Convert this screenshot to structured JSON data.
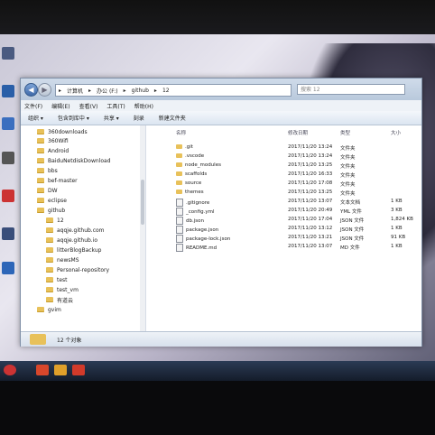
{
  "window": {
    "address_path": [
      "计算机",
      "办公 (F:)",
      "github",
      "12"
    ],
    "search_placeholder": "搜索 12",
    "menu": [
      "文件(F)",
      "编辑(E)",
      "查看(V)",
      "工具(T)",
      "帮助(H)"
    ],
    "toolbar": [
      "组织 ▾",
      "包含到库中 ▾",
      "共享 ▾",
      "刻录",
      "新建文件夹"
    ]
  },
  "nav": {
    "items": [
      {
        "label": "360downloads",
        "indent": 0
      },
      {
        "label": "360Wifi",
        "indent": 0
      },
      {
        "label": "Android",
        "indent": 0
      },
      {
        "label": "BaiduNetdiskDownload",
        "indent": 0
      },
      {
        "label": "bbs",
        "indent": 0
      },
      {
        "label": "bef-master",
        "indent": 0
      },
      {
        "label": "DW",
        "indent": 0
      },
      {
        "label": "eclipse",
        "indent": 0
      },
      {
        "label": "github",
        "indent": 0
      },
      {
        "label": "12",
        "indent": 1
      },
      {
        "label": "aqqje.github.com",
        "indent": 1
      },
      {
        "label": "aqqje.github.io",
        "indent": 1
      },
      {
        "label": "litterBlogBackup",
        "indent": 1
      },
      {
        "label": "newsMS",
        "indent": 1
      },
      {
        "label": "Personal-repository",
        "indent": 1
      },
      {
        "label": "test",
        "indent": 1
      },
      {
        "label": "test_vm",
        "indent": 1
      },
      {
        "label": "有道云",
        "indent": 1
      },
      {
        "label": "gvim",
        "indent": 0
      }
    ]
  },
  "columns": {
    "name": "名称",
    "date": "修改日期",
    "type": "类型",
    "size": "大小"
  },
  "files": [
    {
      "name": ".git",
      "date": "2017/11/20 13:24",
      "type": "文件夹",
      "size": "",
      "folder": true
    },
    {
      "name": ".vscode",
      "date": "2017/11/20 13:24",
      "type": "文件夹",
      "size": "",
      "folder": true
    },
    {
      "name": "node_modules",
      "date": "2017/11/20 13:25",
      "type": "文件夹",
      "size": "",
      "folder": true
    },
    {
      "name": "scaffolds",
      "date": "2017/11/20 16:33",
      "type": "文件夹",
      "size": "",
      "folder": true
    },
    {
      "name": "source",
      "date": "2017/11/20 17:08",
      "type": "文件夹",
      "size": "",
      "folder": true
    },
    {
      "name": "themes",
      "date": "2017/11/20 13:25",
      "type": "文件夹",
      "size": "",
      "folder": true
    },
    {
      "name": ".gitignore",
      "date": "2017/11/20 13:07",
      "type": "文本文档",
      "size": "1 KB",
      "folder": false
    },
    {
      "name": "_config.yml",
      "date": "2017/11/20 20:49",
      "type": "YML 文件",
      "size": "3 KB",
      "folder": false
    },
    {
      "name": "db.json",
      "date": "2017/11/20 17:04",
      "type": "JSON 文件",
      "size": "1,824 KB",
      "folder": false
    },
    {
      "name": "package.json",
      "date": "2017/11/20 13:12",
      "type": "JSON 文件",
      "size": "1 KB",
      "folder": false
    },
    {
      "name": "package-lock.json",
      "date": "2017/11/20 13:21",
      "type": "JSON 文件",
      "size": "91 KB",
      "folder": false
    },
    {
      "name": "README.md",
      "date": "2017/11/20 13:07",
      "type": "MD 文件",
      "size": "1 KB",
      "folder": false
    }
  ],
  "status": {
    "count": "12 个对象"
  }
}
